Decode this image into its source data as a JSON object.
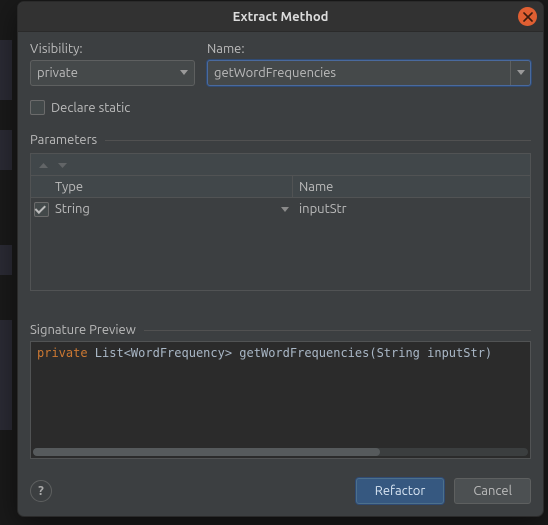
{
  "dialog": {
    "title": "Extract Method",
    "visibility_label": "Visibility:",
    "visibility_value": "private",
    "name_label": "Name:",
    "name_value": "getWordFrequencies",
    "declare_static_label": "Declare static",
    "declare_static_checked": false,
    "parameters_label": "Parameters",
    "columns": {
      "type": "Type",
      "name": "Name"
    },
    "parameters": [
      {
        "enabled": true,
        "type": "String",
        "name": "inputStr"
      }
    ],
    "signature_label": "Signature Preview",
    "signature_keyword": "private",
    "signature_rest": " List<WordFrequency> getWordFrequencies(String inputStr)",
    "help_label": "?",
    "refactor_label": "Refactor",
    "cancel_label": "Cancel"
  }
}
